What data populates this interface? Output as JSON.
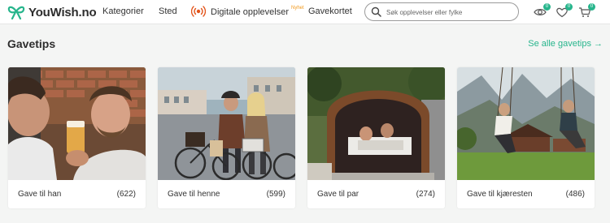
{
  "brand": {
    "name": "YouWish.no",
    "color": "#27b58c"
  },
  "nav": {
    "kategorier": "Kategorier",
    "sted": "Sted",
    "digitale": "Digitale opplevelser",
    "nyhet_badge": "Nyhet",
    "gavekortet": "Gavekortet"
  },
  "search": {
    "placeholder": "Søk opplevelser eller fylke",
    "value": ""
  },
  "header_icons": {
    "viewed_count": "0",
    "favorites_count": "0",
    "cart_count": "0"
  },
  "section": {
    "title": "Gavetips",
    "see_all": "Se alle gavetips →"
  },
  "cards": [
    {
      "label": "Gave til han",
      "count": "(622)"
    },
    {
      "label": "Gave til henne",
      "count": "(599)"
    },
    {
      "label": "Gave til par",
      "count": "(274)"
    },
    {
      "label": "Gave til kjæresten",
      "count": "(486)"
    }
  ]
}
